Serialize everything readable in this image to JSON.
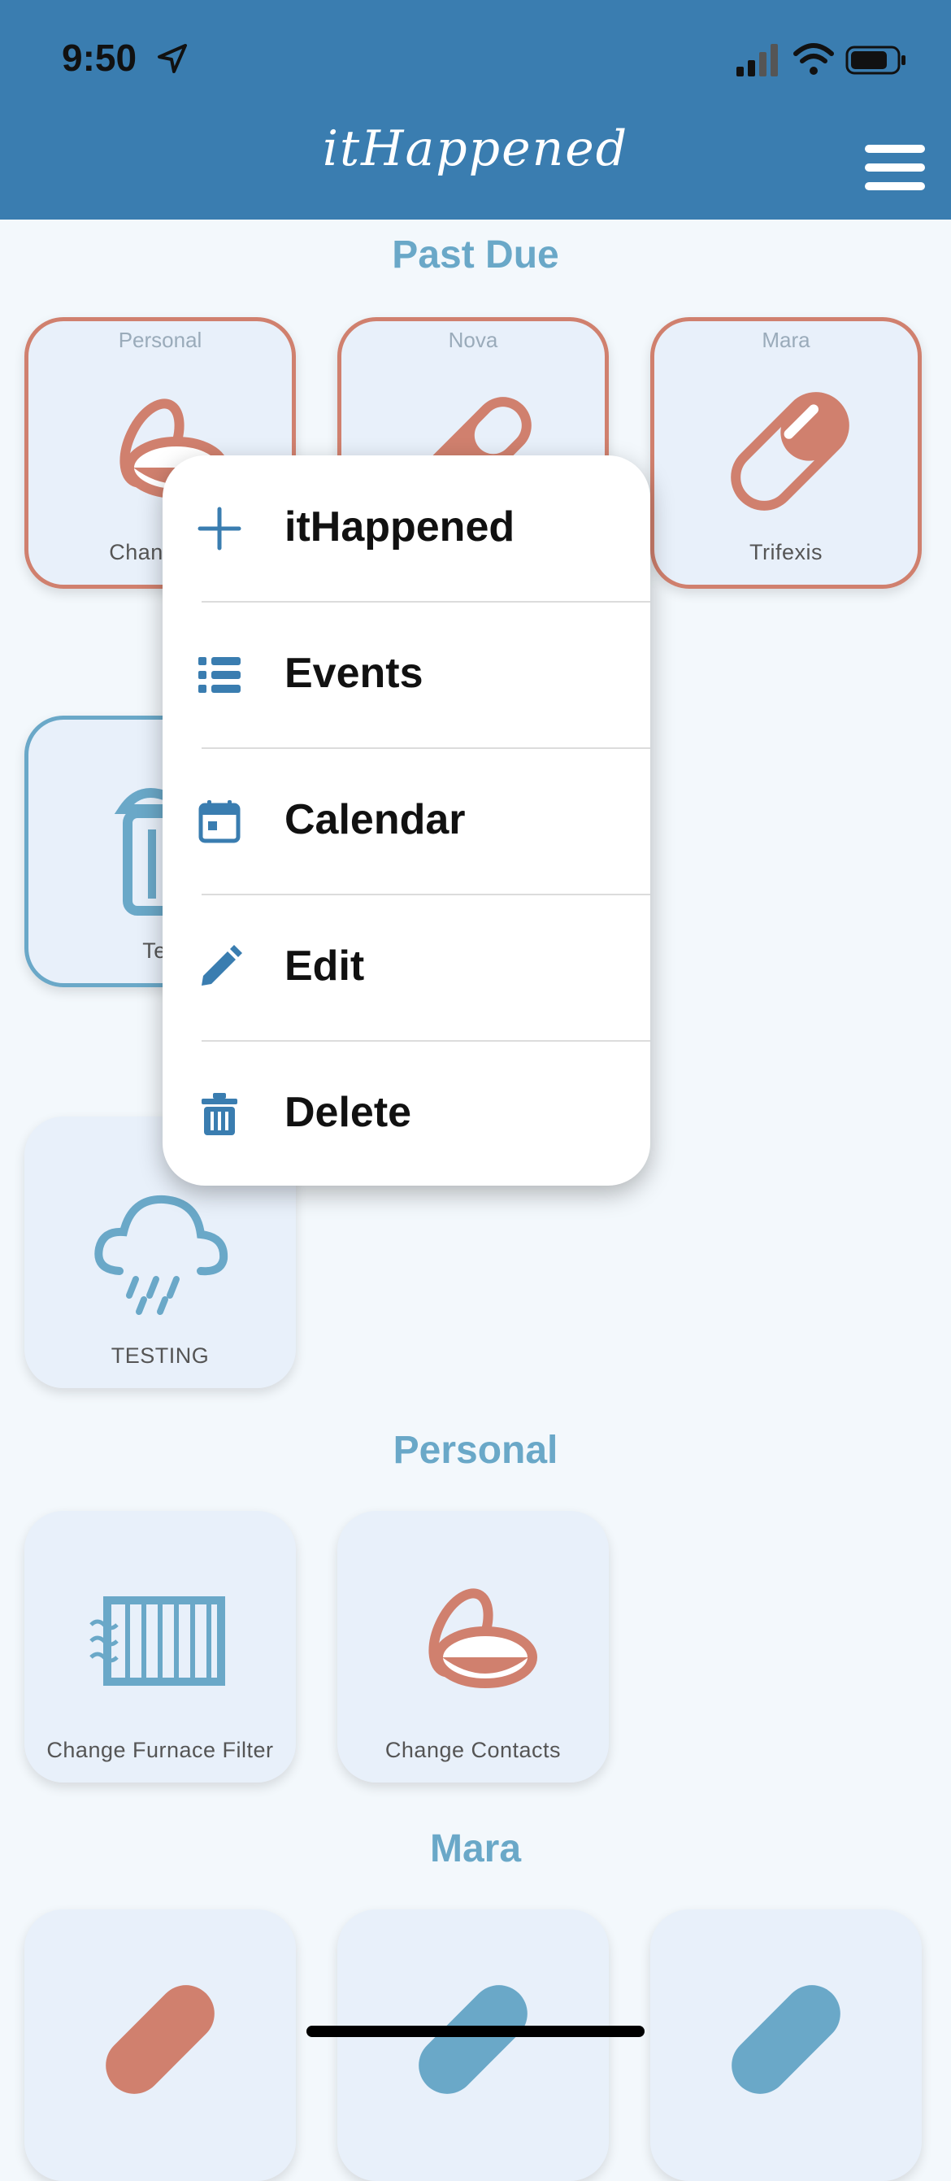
{
  "status_bar": {
    "time": "9:50"
  },
  "header": {
    "title": "itHappened",
    "menu_icon": "hamburger-menu-icon"
  },
  "colors": {
    "header": "#3a7db0",
    "overdue": "#d0806e",
    "accent": "#6aa8c8"
  },
  "sections": {
    "past_due": "Past Due",
    "personal": "Personal",
    "mara": "Mara"
  },
  "tiles": {
    "past_due_1": {
      "category": "Personal",
      "label": "Change Contacts",
      "label_visible": "Change C",
      "icon": "contact-lens-icon"
    },
    "past_due_2": {
      "category": "Nova",
      "icon": "pill-icon"
    },
    "past_due_3": {
      "category": "Mara",
      "label": "Trifexis",
      "icon": "pill-icon"
    },
    "selected": {
      "label_visible": "Tes",
      "icon": "trash-can-icon"
    },
    "testing": {
      "label": "TESTING",
      "icon": "rain-cloud-icon"
    },
    "personal_1": {
      "label": "Change Furnace Filter",
      "icon": "furnace-filter-icon"
    },
    "personal_2": {
      "label": "Change Contacts",
      "icon": "contact-lens-icon"
    }
  },
  "context_menu": {
    "items": [
      {
        "label": "itHappened",
        "icon": "plus-icon"
      },
      {
        "label": "Events",
        "icon": "list-icon"
      },
      {
        "label": "Calendar",
        "icon": "calendar-icon"
      },
      {
        "label": "Edit",
        "icon": "pencil-icon"
      },
      {
        "label": "Delete",
        "icon": "trash-icon"
      }
    ]
  }
}
